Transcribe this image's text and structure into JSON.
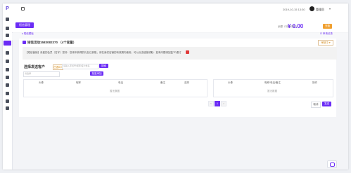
{
  "topbar": {
    "datetime": "2019-10-15 13:30",
    "user_name": "管理员",
    "user_arrow": "▾"
  },
  "actions": {
    "recharge_label": "短信管理",
    "balance_label": "余额（可用/冻结）",
    "balance_amount": "¥ 0.00",
    "pay_label": "充值"
  },
  "breadcrumb": {
    "left": "▸ 短信模板",
    "right": "⊡ 申请记录"
  },
  "template": {
    "title": "短信活动1583082370 （4个变量）",
    "status": "审核中 ▾"
  },
  "notice": {
    "text": "【短信营销】亲爱的会员（名字）您好：您来年获得的礼包已到账，请在我们店铺的有效期内使用，可以点击链接领取：如有问题请回复TD退订"
  },
  "recipients": {
    "title": "选择发送客户",
    "badge": "已选0人",
    "phone_placeholder": "请输入手机号/昵称/客户姓名",
    "search_label": "搜索",
    "group_placeholder": "请选择",
    "clear_label": "批量添加"
  },
  "left_table": {
    "headers": [
      "头像",
      "昵称",
      "电话",
      "备注",
      "选择"
    ],
    "empty": "暂无数据"
  },
  "right_table": {
    "headers": [
      "头像",
      "昵称/电话/备注",
      "操作"
    ],
    "empty": "暂无数据"
  },
  "pagination": {
    "prev": "‹",
    "current": "1",
    "next": "›"
  },
  "footer": {
    "cancel_label": "取消",
    "ok_label": "发送"
  },
  "colors": {
    "accent": "#6b2cf5",
    "warning": "#f0a030"
  }
}
